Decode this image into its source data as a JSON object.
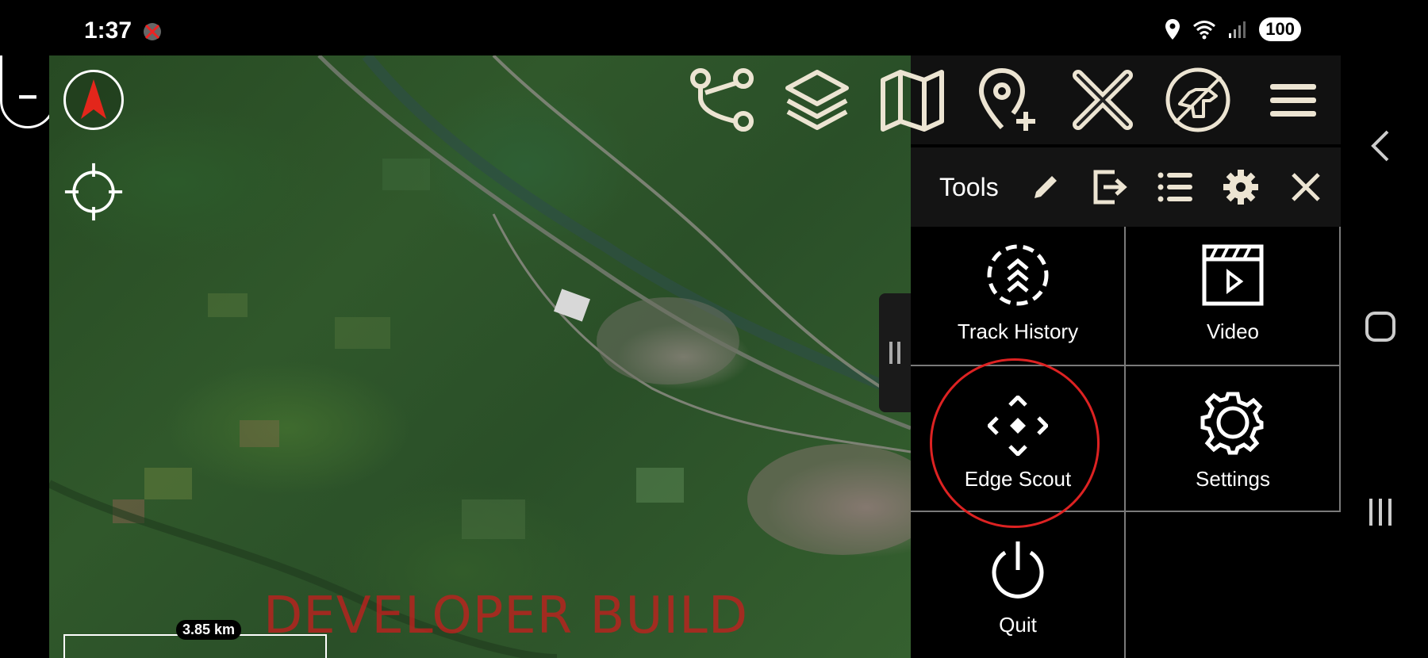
{
  "status_bar": {
    "time": "1:37",
    "battery": "100"
  },
  "map": {
    "watermark": "DEVELOPER BUILD",
    "scale_label": "3.85 km"
  },
  "map_controls": {
    "compass_icon": "north-arrow-icon",
    "locate_icon": "crosshair-icon",
    "zoom_in": "+",
    "zoom_out": "–"
  },
  "toolbar": {
    "icons": [
      "route-icon",
      "layers-icon",
      "map-icon",
      "add-waypoint-icon",
      "close-x-icon",
      "dog-tracker-icon",
      "menu-icon"
    ]
  },
  "tools_panel": {
    "title": "Tools",
    "header_icons": [
      "pencil-icon",
      "export-icon",
      "list-icon",
      "gear-icon",
      "close-icon"
    ],
    "items": [
      {
        "label": "Track History",
        "icon": "track-history-icon"
      },
      {
        "label": "Video",
        "icon": "video-icon"
      },
      {
        "label": "Edge Scout",
        "icon": "edge-scout-icon"
      },
      {
        "label": "Settings",
        "icon": "settings-gear-icon"
      },
      {
        "label": "Quit",
        "icon": "power-icon"
      }
    ]
  },
  "colors": {
    "accent_icon": "#ece4d2",
    "highlight_ring": "#d22222",
    "watermark": "#c81e1e",
    "grid_divider": "#7a7a7a"
  }
}
